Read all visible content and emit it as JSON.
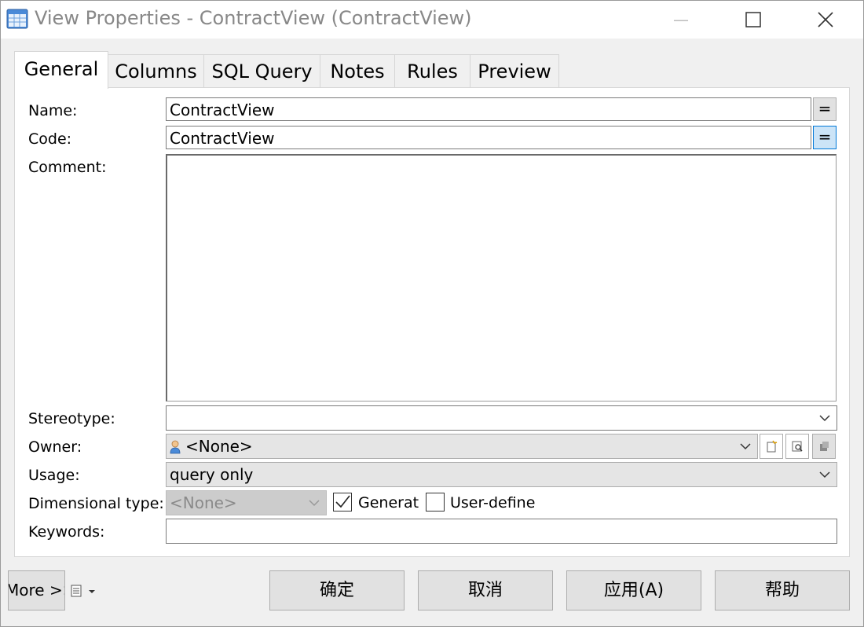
{
  "window": {
    "title": "View Properties - ContractView (ContractView)",
    "minimize_glyph": "—",
    "maximize_glyph": "☐",
    "close_glyph": "✕"
  },
  "tabs": [
    {
      "label": "General",
      "active": true
    },
    {
      "label": "Columns"
    },
    {
      "label": "SQL Query"
    },
    {
      "label": "Notes"
    },
    {
      "label": "Rules"
    },
    {
      "label": "Preview"
    }
  ],
  "form": {
    "name_label": "Name:",
    "name_value": "ContractView",
    "code_label": "Code:",
    "code_value": "ContractView",
    "eq_label": "=",
    "comment_label": "Comment:",
    "comment_value": "",
    "stereotype_label": "Stereotype:",
    "stereotype_value": "",
    "owner_label": "Owner:",
    "owner_value": "<None>",
    "usage_label": "Usage:",
    "usage_value": "query only",
    "dimensional_label": "Dimensional type:",
    "dimensional_value": "<None>",
    "generate_label": "Generat",
    "generate_checked": true,
    "user_defined_label": "User-define",
    "user_defined_checked": false,
    "keywords_label": "Keywords:",
    "keywords_value": ""
  },
  "footer": {
    "more_label": "More >>",
    "ok_label": "确定",
    "cancel_label": "取消",
    "apply_label": "应用(A)",
    "help_label": "帮助"
  },
  "icons": {
    "app": "table-grid-icon",
    "owner": "user-icon",
    "chevron": "chevron-down-icon",
    "new": "new-object-icon",
    "properties": "properties-icon",
    "select": "select-object-icon",
    "menu": "document-menu-icon",
    "checkmark": "checkmark-icon"
  },
  "colors": {
    "title_text": "#888888",
    "pressed_button": "#cce4f7",
    "pressed_border": "#0078d7"
  }
}
